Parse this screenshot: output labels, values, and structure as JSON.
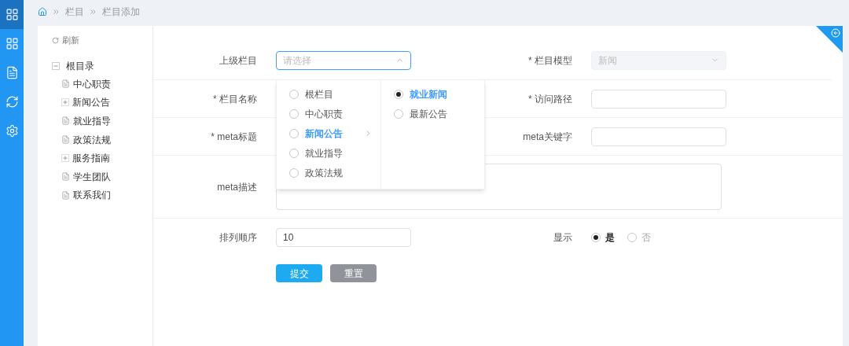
{
  "sidebar": {
    "items": [
      {
        "selected": true
      },
      {
        "selected": false
      },
      {
        "selected": false
      },
      {
        "selected": false
      },
      {
        "selected": false
      }
    ]
  },
  "breadcrumb": [
    "栏目",
    "栏目添加"
  ],
  "tree": {
    "refresh": "刷新",
    "root": {
      "label": "根目录",
      "expanded": true,
      "children": [
        {
          "label": "中心职责",
          "kind": "page"
        },
        {
          "label": "新闻公告",
          "kind": "folder"
        },
        {
          "label": "就业指导",
          "kind": "page"
        },
        {
          "label": "政策法规",
          "kind": "page"
        },
        {
          "label": "服务指南",
          "kind": "folder"
        },
        {
          "label": "学生团队",
          "kind": "page"
        },
        {
          "label": "联系我们",
          "kind": "page"
        }
      ]
    }
  },
  "form": {
    "parent": {
      "label": "上级栏目",
      "placeholder": "请选择",
      "open": true
    },
    "model": {
      "label": "* 栏目模型",
      "value": "新闻",
      "disabled": true
    },
    "name": {
      "label": "* 栏目名称"
    },
    "path": {
      "label": "* 访问路径"
    },
    "meta_title": {
      "label": "* meta标题"
    },
    "meta_keywords": {
      "label": "meta关键字"
    },
    "meta_desc": {
      "label": "meta描述"
    },
    "sort": {
      "label": "排列顺序",
      "value": "10"
    },
    "display": {
      "label": "显示",
      "options": [
        {
          "label": "是",
          "selected": true
        },
        {
          "label": "否",
          "selected": false
        }
      ]
    }
  },
  "cascader": {
    "columns": [
      [
        {
          "label": "根栏目",
          "selected": false,
          "active": false,
          "has_children": false
        },
        {
          "label": "中心职责",
          "selected": false,
          "active": false,
          "has_children": false
        },
        {
          "label": "新闻公告",
          "selected": false,
          "active": true,
          "has_children": true
        },
        {
          "label": "就业指导",
          "selected": false,
          "active": false,
          "has_children": false
        },
        {
          "label": "政策法规",
          "selected": false,
          "active": false,
          "has_children": false
        }
      ],
      [
        {
          "label": "就业新闻",
          "selected": true,
          "active": true,
          "has_children": false
        },
        {
          "label": "最新公告",
          "selected": false,
          "active": false,
          "has_children": false
        }
      ]
    ]
  },
  "buttons": [
    {
      "label": "提交",
      "kind": "primary"
    },
    {
      "label": "重置",
      "kind": "secondary"
    }
  ]
}
